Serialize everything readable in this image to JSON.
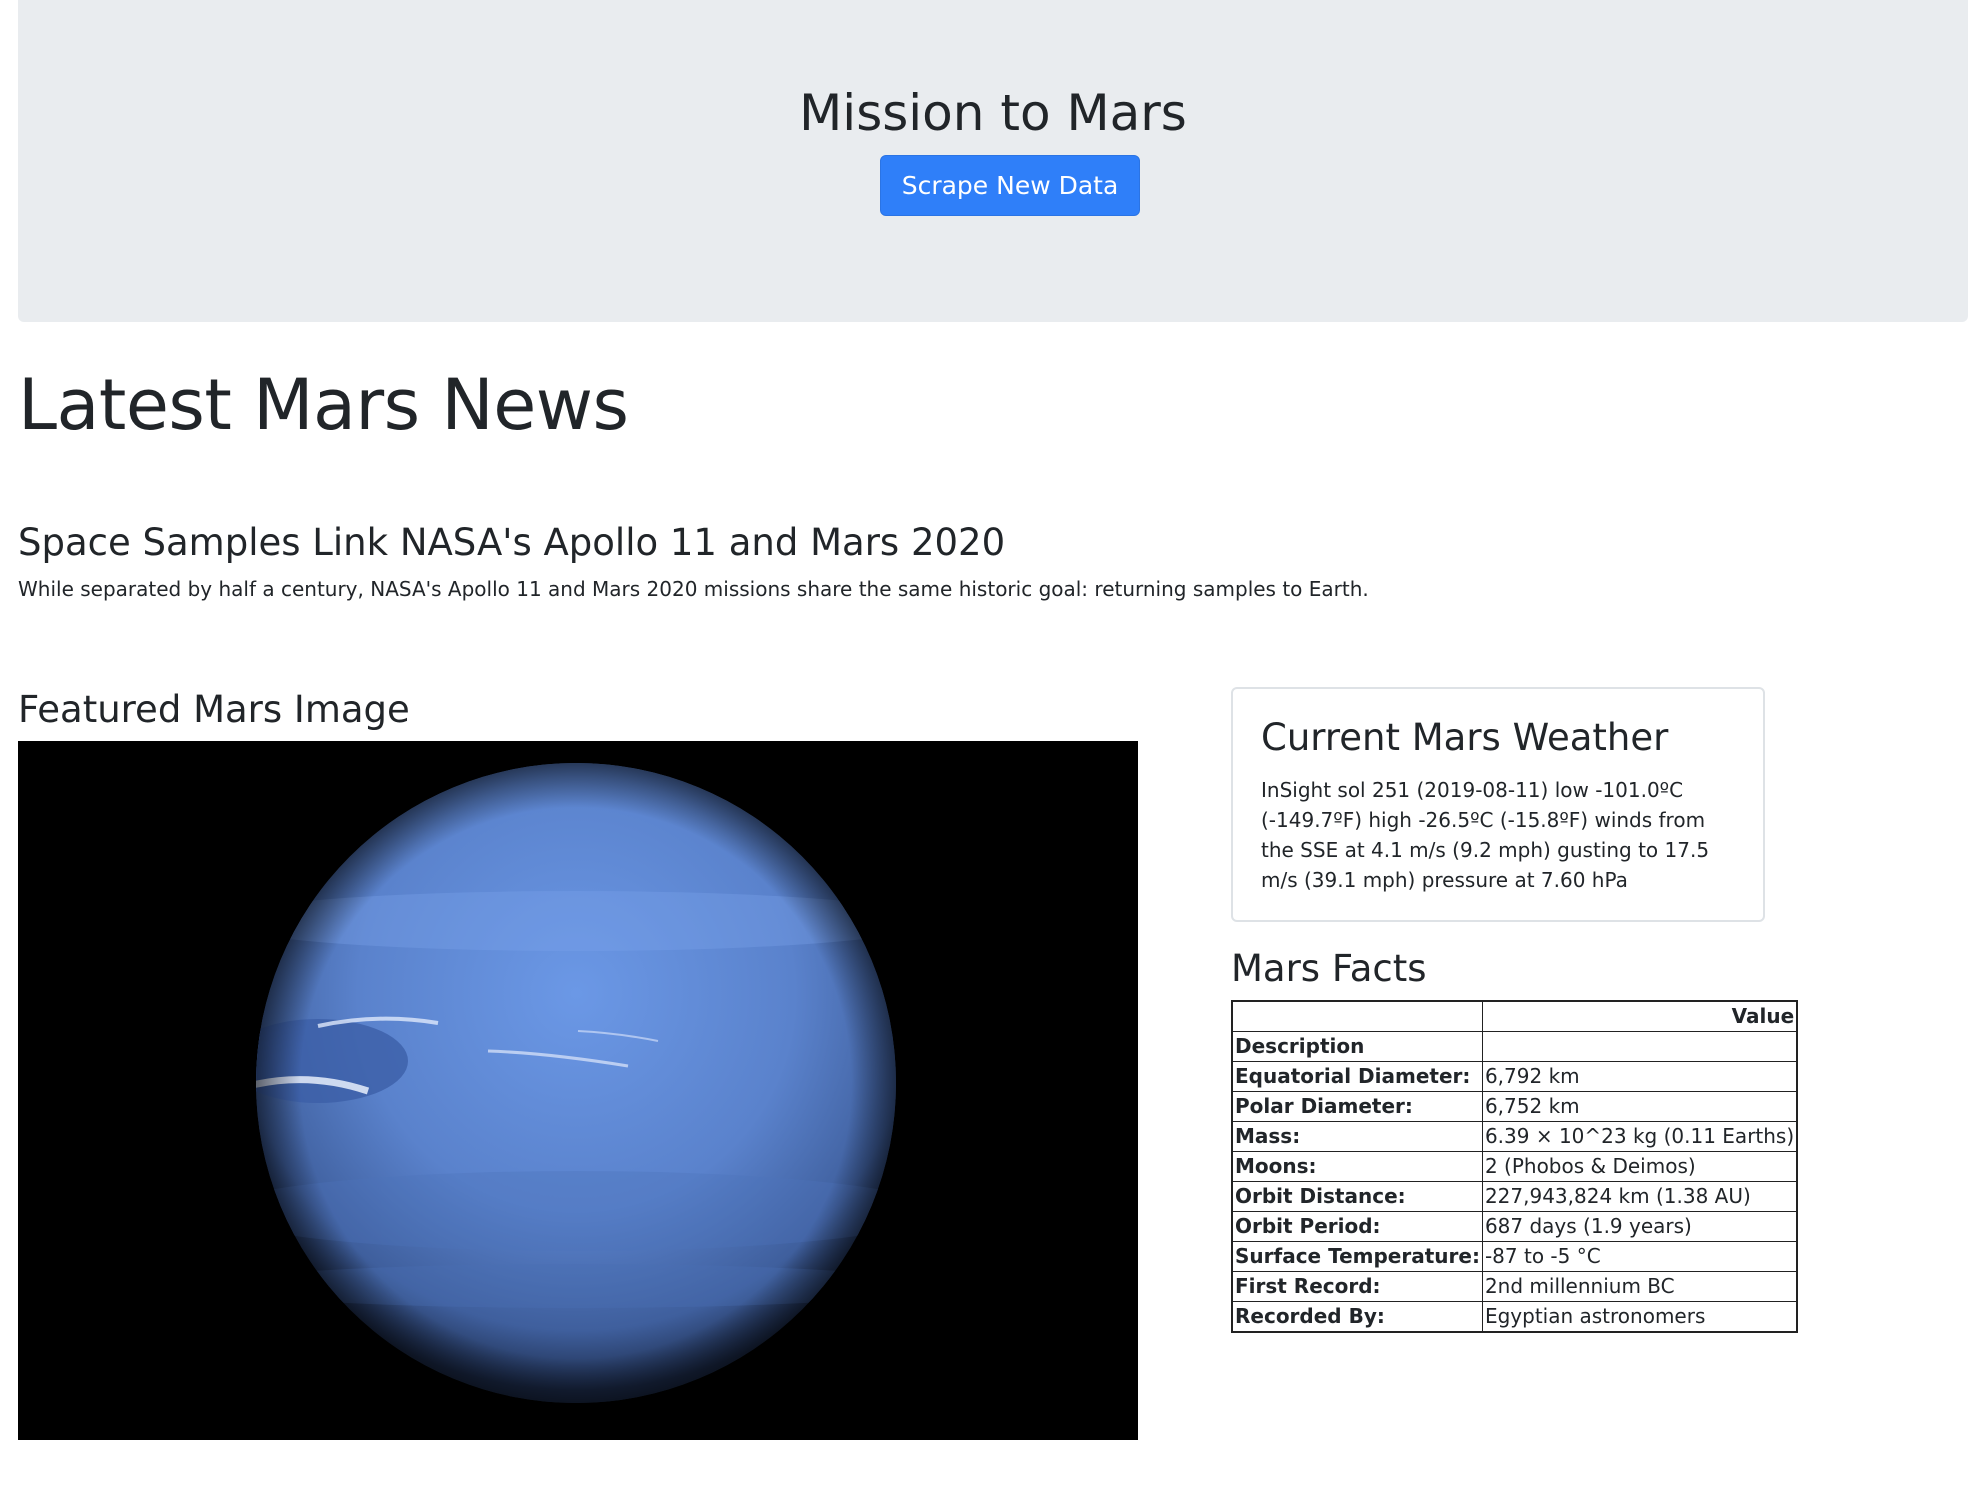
{
  "header": {
    "title": "Mission to Mars",
    "scrape_button_label": "Scrape New Data"
  },
  "news": {
    "section_heading": "Latest Mars News",
    "title": "Space Samples Link NASA's Apollo 11 and Mars 2020",
    "teaser": "While separated by half a century, NASA's Apollo 11 and Mars 2020 missions share the same historic goal: returning samples to Earth."
  },
  "featured": {
    "heading": "Featured Mars Image"
  },
  "weather": {
    "heading": "Current Mars Weather",
    "text": "InSight sol 251 (2019-08-11) low -101.0ºC (-149.7ºF) high -26.5ºC (-15.8ºF) winds from the SSE at 4.1 m/s (9.2 mph) gusting to 17.5 m/s (39.1 mph) pressure at 7.60 hPa"
  },
  "facts": {
    "heading": "Mars Facts",
    "value_header": "Value",
    "index_header": "Description",
    "rows": [
      {
        "label": "Equatorial Diameter:",
        "value": "6,792 km"
      },
      {
        "label": "Polar Diameter:",
        "value": "6,752 km"
      },
      {
        "label": "Mass:",
        "value": "6.39 × 10^23 kg (0.11 Earths)"
      },
      {
        "label": "Moons:",
        "value": "2 (Phobos & Deimos)"
      },
      {
        "label": "Orbit Distance:",
        "value": "227,943,824 km (1.38 AU)"
      },
      {
        "label": "Orbit Period:",
        "value": "687 days (1.9 years)"
      },
      {
        "label": "Surface Temperature:",
        "value": "-87 to -5 °C"
      },
      {
        "label": "First Record:",
        "value": "2nd millennium BC"
      },
      {
        "label": "Recorded By:",
        "value": "Egyptian astronomers"
      }
    ]
  },
  "colors": {
    "jumbotron_bg": "#e9ecef",
    "primary_button": "#2f7ff9",
    "planet_blue": "#5b86d6"
  }
}
